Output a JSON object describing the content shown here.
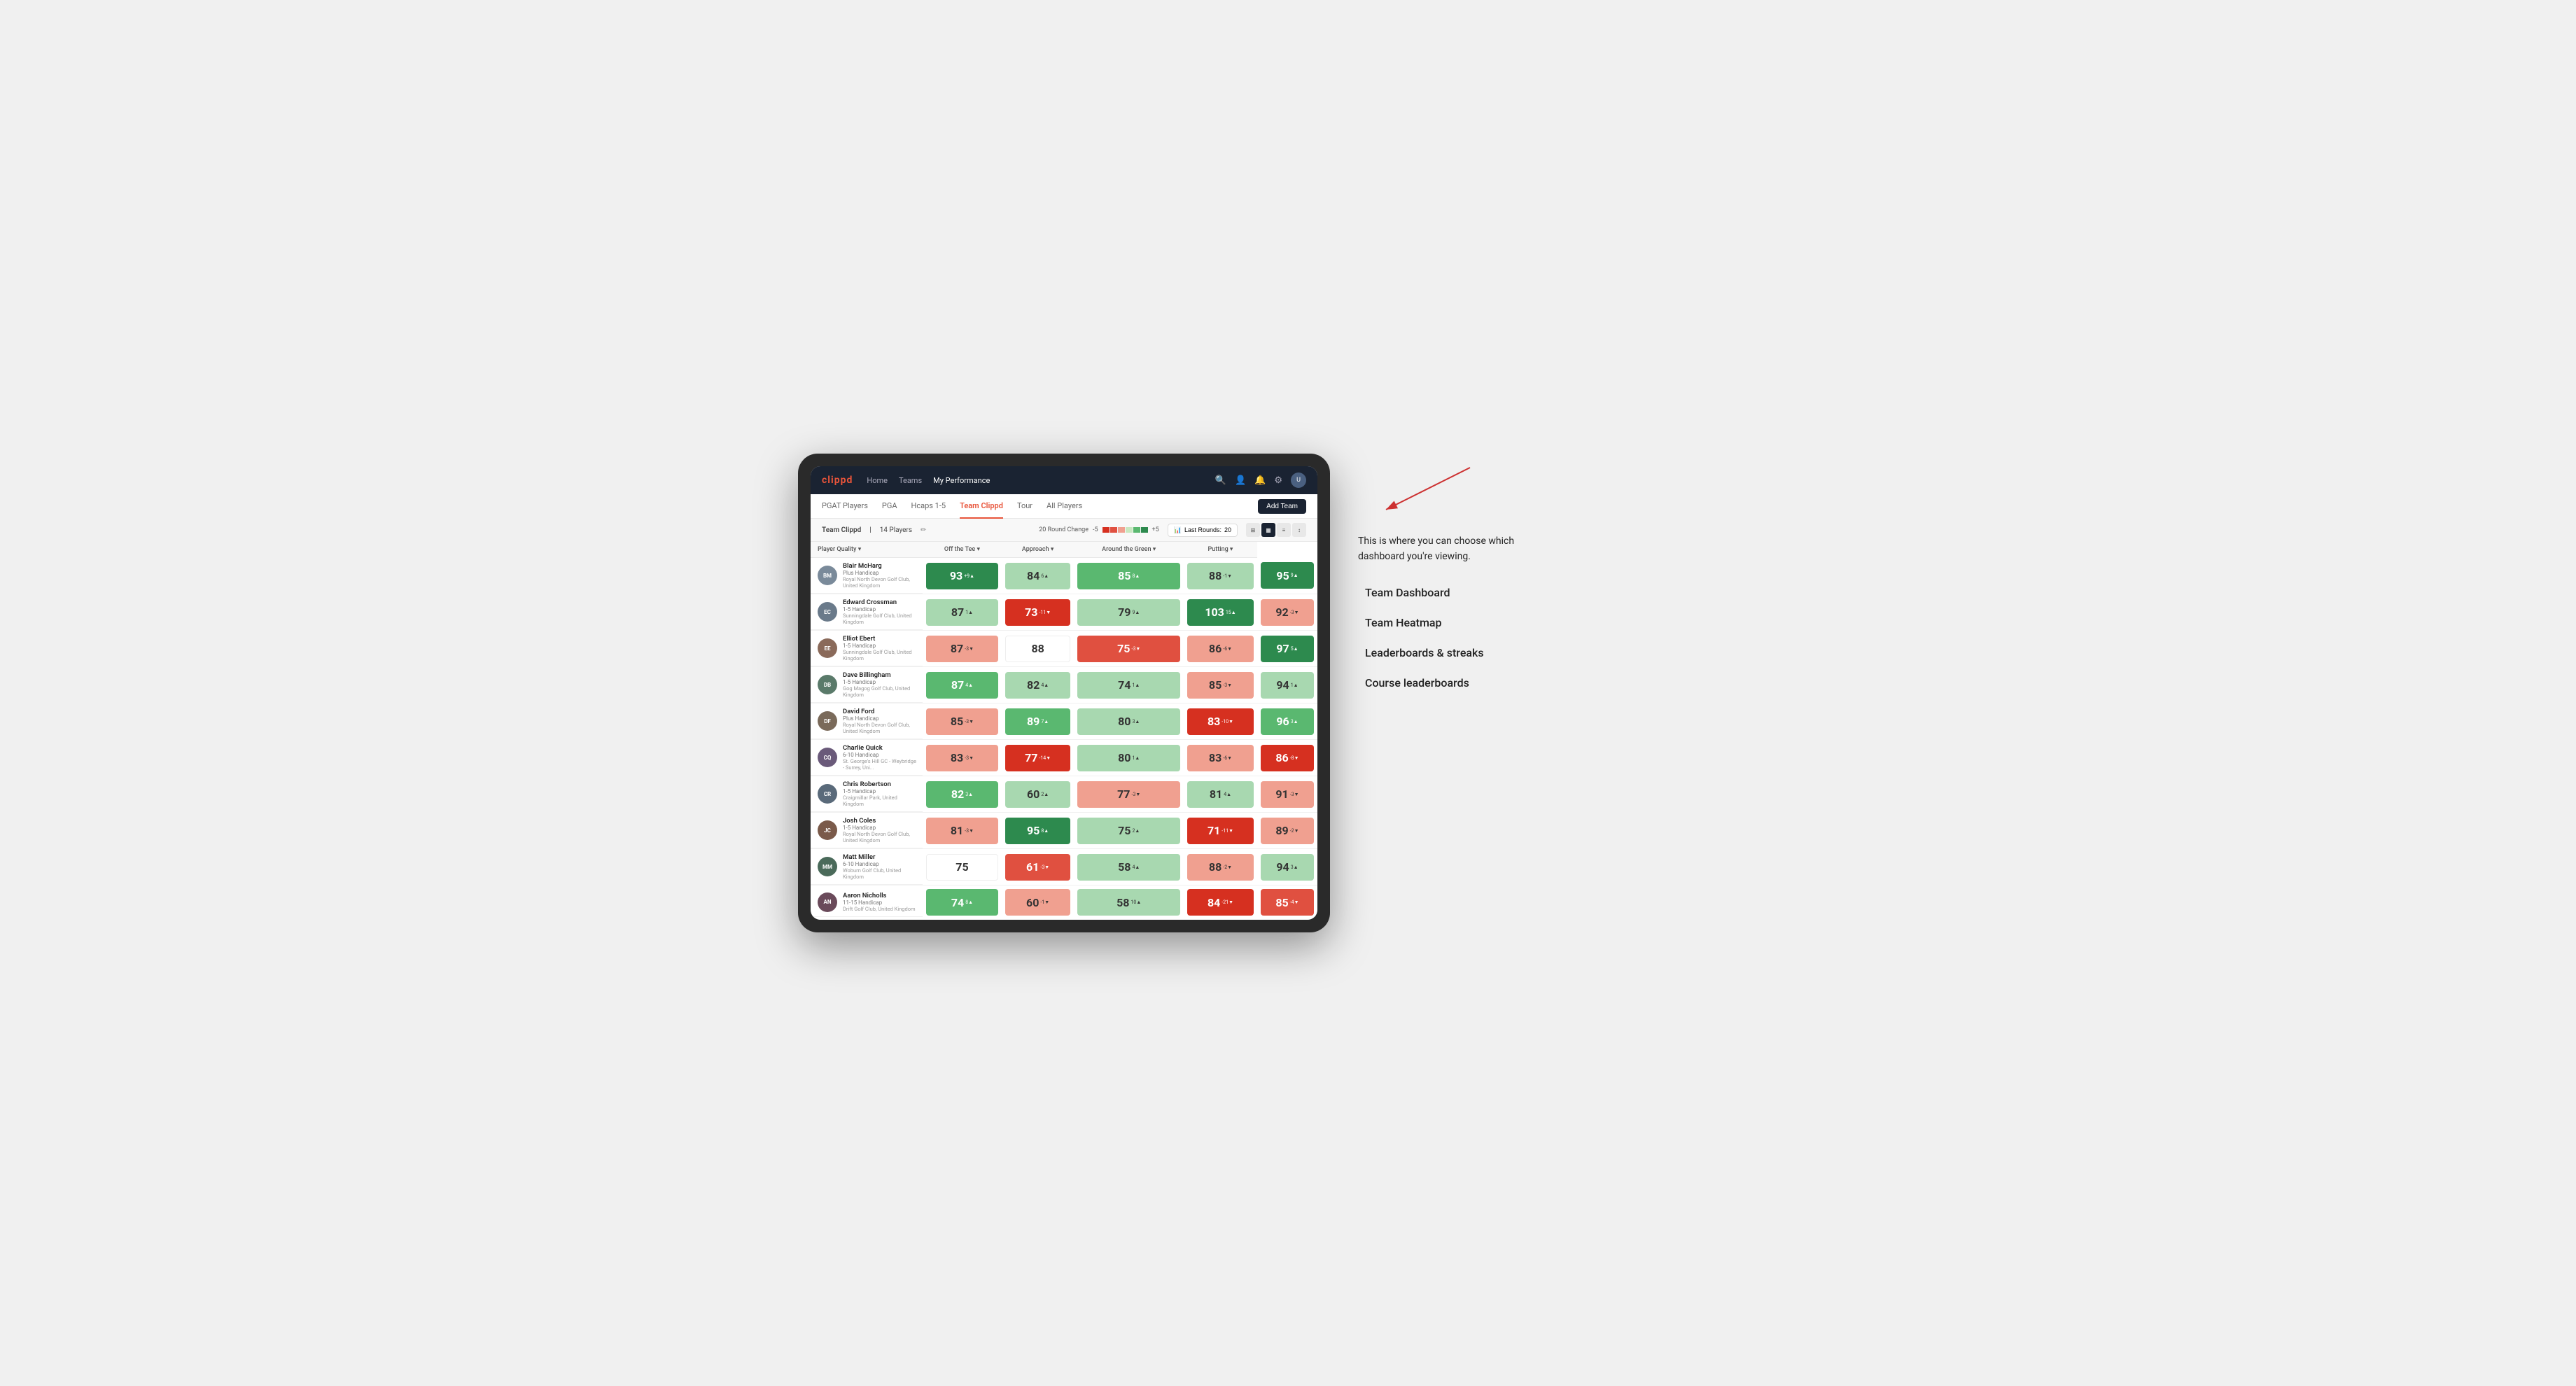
{
  "annotation": {
    "intro": "This is where you can choose which dashboard you're viewing.",
    "items": [
      "Team Dashboard",
      "Team Heatmap",
      "Leaderboards & streaks",
      "Course leaderboards"
    ]
  },
  "nav": {
    "logo": "clippd",
    "links": [
      "Home",
      "Teams",
      "My Performance"
    ],
    "active_link": "My Performance"
  },
  "tabs": {
    "items": [
      "PGAT Players",
      "PGA",
      "Hcaps 1-5",
      "Team Clippd",
      "Tour",
      "All Players"
    ],
    "active": "Team Clippd",
    "add_team_label": "Add Team"
  },
  "team_bar": {
    "name": "Team Clippd",
    "count": "14 Players",
    "round_change_label": "20 Round Change",
    "range_low": "-5",
    "range_high": "+5",
    "last_rounds_label": "Last Rounds:",
    "last_rounds_value": "20"
  },
  "table": {
    "headers": {
      "player": "Player Quality ▾",
      "tee": "Off the Tee ▾",
      "approach": "Approach ▾",
      "around_green": "Around the Green ▾",
      "putting": "Putting ▾"
    },
    "players": [
      {
        "name": "Blair McHarg",
        "handicap": "Plus Handicap",
        "club": "Royal North Devon Golf Club, United Kingdom",
        "initials": "BM",
        "avatar_color": "#7a8a9a",
        "scores": [
          {
            "val": 93,
            "change": "+9",
            "dir": "up",
            "bg": "bg-green-dark"
          },
          {
            "val": 84,
            "change": "6",
            "dir": "up",
            "bg": "bg-green-light"
          },
          {
            "val": 85,
            "change": "8",
            "dir": "up",
            "bg": "bg-green-med"
          },
          {
            "val": 88,
            "change": "-1",
            "dir": "down",
            "bg": "bg-green-light"
          },
          {
            "val": 95,
            "change": "9",
            "dir": "up",
            "bg": "bg-green-dark"
          }
        ]
      },
      {
        "name": "Edward Crossman",
        "handicap": "1-5 Handicap",
        "club": "Sunningdale Golf Club, United Kingdom",
        "initials": "EC",
        "avatar_color": "#6a7a8a",
        "scores": [
          {
            "val": 87,
            "change": "1",
            "dir": "up",
            "bg": "bg-green-light"
          },
          {
            "val": 73,
            "change": "-11",
            "dir": "down",
            "bg": "bg-red-dark"
          },
          {
            "val": 79,
            "change": "9",
            "dir": "up",
            "bg": "bg-green-light"
          },
          {
            "val": 103,
            "change": "15",
            "dir": "up",
            "bg": "bg-green-dark"
          },
          {
            "val": 92,
            "change": "-3",
            "dir": "down",
            "bg": "bg-red-light"
          }
        ]
      },
      {
        "name": "Elliot Ebert",
        "handicap": "1-5 Handicap",
        "club": "Sunningdale Golf Club, United Kingdom",
        "initials": "EE",
        "avatar_color": "#8a6a5a",
        "scores": [
          {
            "val": 87,
            "change": "-3",
            "dir": "down",
            "bg": "bg-red-light"
          },
          {
            "val": 88,
            "change": "",
            "dir": "",
            "bg": "bg-white"
          },
          {
            "val": 75,
            "change": "-3",
            "dir": "down",
            "bg": "bg-red-med"
          },
          {
            "val": 86,
            "change": "-6",
            "dir": "down",
            "bg": "bg-red-light"
          },
          {
            "val": 97,
            "change": "5",
            "dir": "up",
            "bg": "bg-green-dark"
          }
        ]
      },
      {
        "name": "Dave Billingham",
        "handicap": "1-5 Handicap",
        "club": "Gog Magog Golf Club, United Kingdom",
        "initials": "DB",
        "avatar_color": "#5a7a6a",
        "scores": [
          {
            "val": 87,
            "change": "4",
            "dir": "up",
            "bg": "bg-green-med"
          },
          {
            "val": 82,
            "change": "4",
            "dir": "up",
            "bg": "bg-green-light"
          },
          {
            "val": 74,
            "change": "1",
            "dir": "up",
            "bg": "bg-green-light"
          },
          {
            "val": 85,
            "change": "-3",
            "dir": "down",
            "bg": "bg-red-light"
          },
          {
            "val": 94,
            "change": "1",
            "dir": "up",
            "bg": "bg-green-light"
          }
        ]
      },
      {
        "name": "David Ford",
        "handicap": "Plus Handicap",
        "club": "Royal North Devon Golf Club, United Kingdom",
        "initials": "DF",
        "avatar_color": "#7a6a5a",
        "scores": [
          {
            "val": 85,
            "change": "-3",
            "dir": "down",
            "bg": "bg-red-light"
          },
          {
            "val": 89,
            "change": "7",
            "dir": "up",
            "bg": "bg-green-med"
          },
          {
            "val": 80,
            "change": "3",
            "dir": "up",
            "bg": "bg-green-light"
          },
          {
            "val": 83,
            "change": "-10",
            "dir": "down",
            "bg": "bg-red-dark"
          },
          {
            "val": 96,
            "change": "3",
            "dir": "up",
            "bg": "bg-green-med"
          }
        ]
      },
      {
        "name": "Charlie Quick",
        "handicap": "6-10 Handicap",
        "club": "St. George's Hill GC - Weybridge - Surrey, Uni...",
        "initials": "CQ",
        "avatar_color": "#6a5a7a",
        "scores": [
          {
            "val": 83,
            "change": "-3",
            "dir": "down",
            "bg": "bg-red-light"
          },
          {
            "val": 77,
            "change": "-14",
            "dir": "down",
            "bg": "bg-red-dark"
          },
          {
            "val": 80,
            "change": "1",
            "dir": "up",
            "bg": "bg-green-light"
          },
          {
            "val": 83,
            "change": "-6",
            "dir": "down",
            "bg": "bg-red-light"
          },
          {
            "val": 86,
            "change": "-8",
            "dir": "down",
            "bg": "bg-red-dark"
          }
        ]
      },
      {
        "name": "Chris Robertson",
        "handicap": "1-5 Handicap",
        "club": "Craigmillar Park, United Kingdom",
        "initials": "CR",
        "avatar_color": "#5a6a7a",
        "scores": [
          {
            "val": 82,
            "change": "3",
            "dir": "up",
            "bg": "bg-green-med"
          },
          {
            "val": 60,
            "change": "2",
            "dir": "up",
            "bg": "bg-green-light"
          },
          {
            "val": 77,
            "change": "-3",
            "dir": "down",
            "bg": "bg-red-light"
          },
          {
            "val": 81,
            "change": "4",
            "dir": "up",
            "bg": "bg-green-light"
          },
          {
            "val": 91,
            "change": "-3",
            "dir": "down",
            "bg": "bg-red-light"
          }
        ]
      },
      {
        "name": "Josh Coles",
        "handicap": "1-5 Handicap",
        "club": "Royal North Devon Golf Club, United Kingdom",
        "initials": "JC",
        "avatar_color": "#7a5a4a",
        "scores": [
          {
            "val": 81,
            "change": "-3",
            "dir": "down",
            "bg": "bg-red-light"
          },
          {
            "val": 95,
            "change": "8",
            "dir": "up",
            "bg": "bg-green-dark"
          },
          {
            "val": 75,
            "change": "2",
            "dir": "up",
            "bg": "bg-green-light"
          },
          {
            "val": 71,
            "change": "-11",
            "dir": "down",
            "bg": "bg-red-dark"
          },
          {
            "val": 89,
            "change": "-2",
            "dir": "down",
            "bg": "bg-red-light"
          }
        ]
      },
      {
        "name": "Matt Miller",
        "handicap": "6-10 Handicap",
        "club": "Woburn Golf Club, United Kingdom",
        "initials": "MM",
        "avatar_color": "#4a6a5a",
        "scores": [
          {
            "val": 75,
            "change": "",
            "dir": "",
            "bg": "bg-white"
          },
          {
            "val": 61,
            "change": "-3",
            "dir": "down",
            "bg": "bg-red-med"
          },
          {
            "val": 58,
            "change": "4",
            "dir": "up",
            "bg": "bg-green-light"
          },
          {
            "val": 88,
            "change": "-2",
            "dir": "down",
            "bg": "bg-red-light"
          },
          {
            "val": 94,
            "change": "3",
            "dir": "up",
            "bg": "bg-green-light"
          }
        ]
      },
      {
        "name": "Aaron Nicholls",
        "handicap": "11-15 Handicap",
        "club": "Drift Golf Club, United Kingdom",
        "initials": "AN",
        "avatar_color": "#6a4a5a",
        "scores": [
          {
            "val": 74,
            "change": "8",
            "dir": "up",
            "bg": "bg-green-med"
          },
          {
            "val": 60,
            "change": "-1",
            "dir": "down",
            "bg": "bg-red-light"
          },
          {
            "val": 58,
            "change": "10",
            "dir": "up",
            "bg": "bg-green-light"
          },
          {
            "val": 84,
            "change": "-21",
            "dir": "down",
            "bg": "bg-red-dark"
          },
          {
            "val": 85,
            "change": "-4",
            "dir": "down",
            "bg": "bg-red-med"
          }
        ]
      }
    ]
  }
}
